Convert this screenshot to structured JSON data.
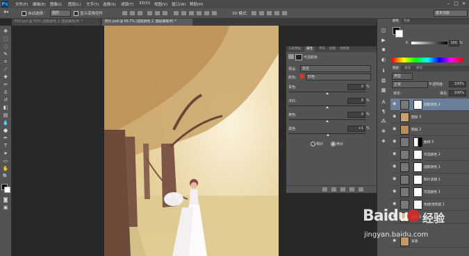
{
  "app": {
    "logo": "Ps"
  },
  "menu": [
    "文件(F)",
    "编辑(E)",
    "图像(I)",
    "图层(L)",
    "文字(Y)",
    "选择(S)",
    "滤镜(T)",
    "3D(D)",
    "视图(V)",
    "窗口(W)",
    "帮助(H)"
  ],
  "options": {
    "auto_select_label": "自动选择：",
    "auto_select_value": "图层",
    "transform_label": "显示变换控件",
    "mode3d_label": "3D 模式：",
    "workspace": "基本功能"
  },
  "tabs": [
    {
      "label": "P03.psd @ 50% (选取颜色 1, 图层蒙版/8) *"
    },
    {
      "label": "原片.psd @ 66.7% (选取颜色 2, 图层蒙版/8) *"
    }
  ],
  "color_panel": {
    "tabs": [
      "颜色",
      "色板"
    ],
    "k_label": "K",
    "k_value": "100",
    "k_unit": "%"
  },
  "layers_panel": {
    "tabs": [
      "图层",
      "通道",
      "路径"
    ],
    "kind_label": "类型",
    "blend_mode": "正常",
    "opacity_label": "不透明度:",
    "opacity_value": "100%",
    "lock_label": "锁定:",
    "fill_label": "填充:",
    "fill_value": "100%",
    "layers": [
      {
        "name": "选取颜色 2"
      },
      {
        "name": "图层 3"
      },
      {
        "name": "图层 2"
      },
      {
        "name": "曲线 3"
      },
      {
        "name": "可选颜色 2"
      },
      {
        "name": "选取颜色 1"
      },
      {
        "name": "照片滤镜 1"
      },
      {
        "name": "可选颜色 1"
      },
      {
        "name": "色相/饱和度 1"
      },
      {
        "name": "图层 1"
      },
      {
        "name": "背景"
      }
    ]
  },
  "properties": {
    "tabs": [
      "工具预设",
      "属性",
      "字符",
      "段落",
      "仿制源"
    ],
    "title": "可选颜色",
    "preset_label": "预设:",
    "preset_value": "自定",
    "colors_label": "颜色:",
    "colors_value": "红色",
    "rows": [
      {
        "label": "青色:",
        "value": "0",
        "unit": "%"
      },
      {
        "label": "洋红:",
        "value": "0",
        "unit": "%"
      },
      {
        "label": "黄色:",
        "value": "0",
        "unit": "%"
      },
      {
        "label": "黑色:",
        "value": "+1",
        "unit": "%"
      }
    ],
    "radio_relative": "相对",
    "radio_absolute": "绝对"
  },
  "watermark": {
    "brand": "Baidu",
    "product": "经验",
    "url": "jingyan.baidu.com"
  },
  "colors": {
    "accent": "#3fa9f5",
    "menubar": "#4a4a4a",
    "panel": "#535353",
    "selected_layer": "#6b7f99",
    "canvas": "#282828"
  }
}
